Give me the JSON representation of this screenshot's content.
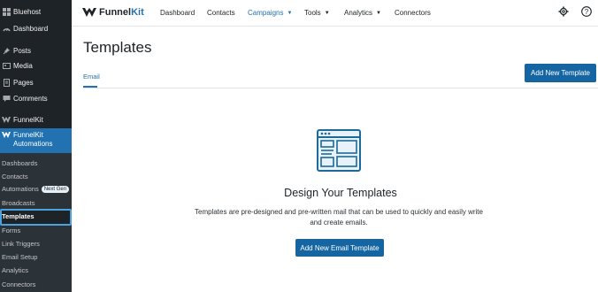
{
  "sidebar": {
    "items": [
      {
        "label": "Bluehost",
        "icon": "bluehost-icon"
      },
      {
        "label": "Dashboard",
        "icon": "dashboard-icon"
      },
      {
        "label": "Posts",
        "icon": "pin-icon"
      },
      {
        "label": "Media",
        "icon": "media-icon"
      },
      {
        "label": "Pages",
        "icon": "pages-icon"
      },
      {
        "label": "Comments",
        "icon": "comments-icon"
      },
      {
        "label": "FunnelKit",
        "icon": "funnelkit-icon"
      }
    ],
    "active": {
      "line1": "FunnelKit",
      "line2": "Automations",
      "icon": "funnelkit-icon"
    },
    "submenu": [
      {
        "label": "Dashboards"
      },
      {
        "label": "Contacts"
      },
      {
        "label": "Automations",
        "badge": "Next Gen"
      },
      {
        "label": "Broadcasts"
      },
      {
        "label": "Templates"
      },
      {
        "label": "Forms"
      },
      {
        "label": "Link Triggers"
      },
      {
        "label": "Email Setup"
      },
      {
        "label": "Analytics"
      },
      {
        "label": "Connectors"
      }
    ]
  },
  "topnav": {
    "logo": {
      "part1": "Funnel",
      "part2": "Kit"
    },
    "items": [
      {
        "label": "Dashboard"
      },
      {
        "label": "Contacts"
      },
      {
        "label": "Campaigns"
      },
      {
        "label": "Tools"
      },
      {
        "label": "Analytics"
      },
      {
        "label": "Connectors"
      }
    ],
    "icons": [
      "gear-icon",
      "help-icon"
    ]
  },
  "main": {
    "title": "Templates",
    "add_button": "Add New Template",
    "tabs": [
      {
        "label": "Email"
      }
    ],
    "empty": {
      "title": "Design Your Templates",
      "description": "Templates are pre-designed and pre-written mail that can be used to quickly and easily write and create emails.",
      "button": "Add New Email Template"
    }
  },
  "colors": {
    "sidebar_bg": "#1d2327",
    "accent": "#2271b1",
    "button": "#1565a3",
    "highlight": "#4aa3df"
  }
}
